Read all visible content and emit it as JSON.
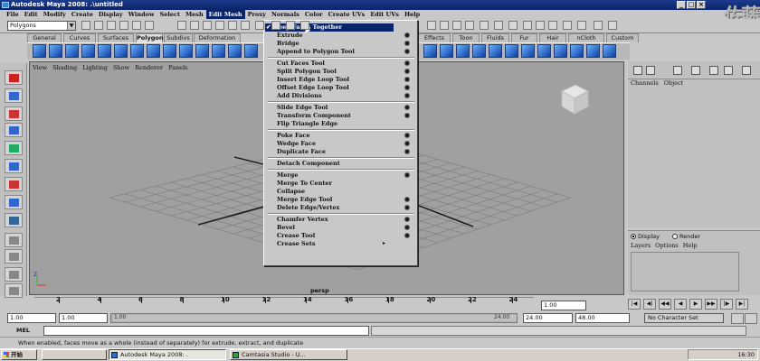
{
  "window": {
    "title": "Autodesk Maya 2008: .\\untitled",
    "watermark": "佐藤"
  },
  "menubar": [
    "File",
    "Edit",
    "Modify",
    "Create",
    "Display",
    "Window",
    "Select",
    "Mesh",
    "Edit Mesh",
    "Proxy",
    "Normals",
    "Color",
    "Create UVs",
    "Edit UVs",
    "Help"
  ],
  "menubar_active": "Edit Mesh",
  "status_line": {
    "mode": "Polygons"
  },
  "shelf": {
    "tabs": [
      "General",
      "Curves",
      "Surfaces",
      "Polygons",
      "Subdivs",
      "Deformation",
      "Effects",
      "Toon",
      "Fluids",
      "Fur",
      "Hair",
      "nCloth",
      "Custom"
    ],
    "active_tab": "Polygons"
  },
  "viewport": {
    "menu": [
      "View",
      "Shading",
      "Lighting",
      "Show",
      "Renderer",
      "Panels"
    ],
    "camera": "persp",
    "axis_label": "Z"
  },
  "dropdown": {
    "items": [
      {
        "label": "Keep Faces Together",
        "checked": true,
        "highlighted": true,
        "option": false
      },
      {
        "label": "Extrude",
        "option": true
      },
      {
        "label": "Bridge",
        "option": true
      },
      {
        "label": "Append to Polygon Tool",
        "option": true
      },
      {
        "sep": true
      },
      {
        "label": "Cut Faces Tool",
        "option": true
      },
      {
        "label": "Split Polygon Tool",
        "option": true
      },
      {
        "label": "Insert Edge Loop Tool",
        "option": true
      },
      {
        "label": "Offset Edge Loop Tool",
        "option": true
      },
      {
        "label": "Add Divisions",
        "option": true
      },
      {
        "sep": true
      },
      {
        "label": "Slide Edge Tool",
        "option": true
      },
      {
        "label": "Transform Component",
        "option": true
      },
      {
        "label": "Flip Triangle Edge",
        "option": false
      },
      {
        "sep": true
      },
      {
        "label": "Poke Face",
        "option": true
      },
      {
        "label": "Wedge Face",
        "option": true
      },
      {
        "label": "Duplicate Face",
        "option": true
      },
      {
        "sep": true
      },
      {
        "label": "Detach Component",
        "option": false
      },
      {
        "sep": true
      },
      {
        "label": "Merge",
        "option": true
      },
      {
        "label": "Merge To Center",
        "option": false
      },
      {
        "label": "Collapse",
        "option": false
      },
      {
        "label": "Merge Edge Tool",
        "option": true
      },
      {
        "label": "Delete Edge/Vertex",
        "option": true
      },
      {
        "sep": true
      },
      {
        "label": "Chamfer Vertex",
        "option": true
      },
      {
        "label": "Bevel",
        "option": true
      },
      {
        "label": "Crease Tool",
        "option": true
      },
      {
        "label": "Crease Sets",
        "submenu": true
      }
    ],
    "check_mark": "✔",
    "submenu_arrow": "▸"
  },
  "channel_box": {
    "menu": [
      "Channels",
      "Object"
    ]
  },
  "layer_editor": {
    "modes": [
      "Display",
      "Render"
    ],
    "selected_mode": "Display",
    "menu": [
      "Layers",
      "Options",
      "Help"
    ]
  },
  "time_slider": {
    "ticks": [
      "2",
      "4",
      "6",
      "8",
      "10",
      "12",
      "14",
      "16",
      "18",
      "20",
      "22",
      "24"
    ],
    "current_frame": "1.00",
    "playback_glyphs": [
      "|◀",
      "◀|",
      "◀◀",
      "◀",
      "▶",
      "▶▶",
      "|▶",
      "▶|"
    ]
  },
  "range_slider": {
    "start_time": "1.00",
    "playback_start": "1.00",
    "range_start_label": "1.00",
    "range_end_label": "24.00",
    "playback_end": "24.00",
    "end_time": "48.00",
    "character_set": "No Character Set"
  },
  "command_line": {
    "label": "MEL"
  },
  "help_line": "When enabled, faces move as a whole (instead of separately) for extrude, extract, and duplicate",
  "taskbar": {
    "start": "开始",
    "tasks": [
      "Autodesk Maya 2008: .",
      "Camtasia Studio - U..."
    ],
    "clock": "16:30"
  },
  "colors": {
    "title_bar": "#0b2468",
    "menu_highlight": "#0a246a",
    "viewport_bg": "#a0a0a0"
  }
}
